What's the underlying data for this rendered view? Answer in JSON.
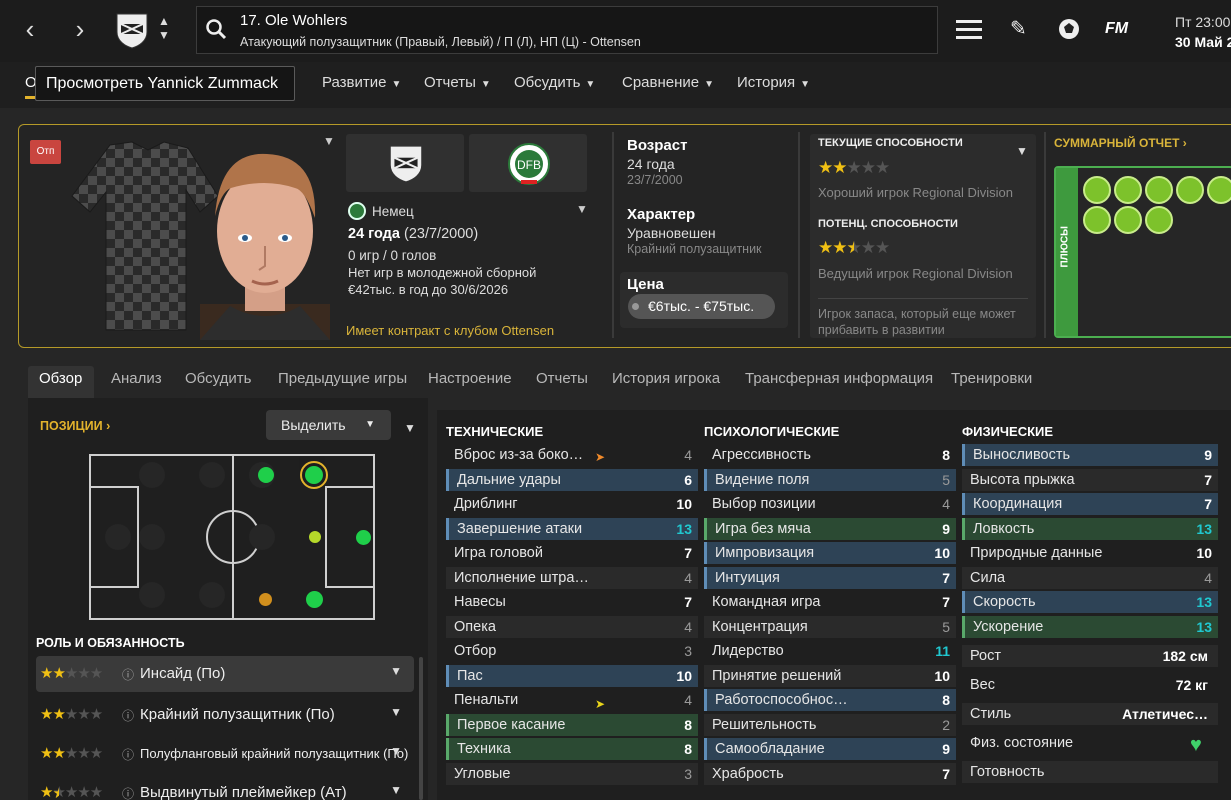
{
  "header": {
    "player_title": "17. Ole Wohlers",
    "player_subtitle": "Атакующий полузащитник (Правый, Левый) / П (Л), НП (Ц) - Ottensen",
    "fm_label": "FM",
    "day": "Пт 23:00",
    "date": "30 Май 2"
  },
  "tooltip": "Просмотреть Yannick Zummack",
  "menu": {
    "first": "О",
    "items": [
      "Развитие",
      "Отчеты",
      "Обсудить",
      "Сравнение",
      "История"
    ]
  },
  "profile": {
    "badge": "Отп",
    "nationality": "Немец",
    "age": "24 года",
    "dob": "(23/7/2000)",
    "games": "0 игр / 0 голов",
    "youth": "Нет игр в молодежной сборной",
    "wage": "€42тыс. в год до 30/6/2026",
    "contract": "Имеет контракт с клубом Ottensen",
    "age_label": "Возраст",
    "age_value": "24 года",
    "age_dob": "23/7/2000",
    "char_label": "Характер",
    "char_value": "Уравновешен",
    "char_sub": "Крайний полузащитник",
    "price_label": "Цена",
    "price_value": "€6тыс. - €75тыс.",
    "ca_label": "ТЕКУЩИЕ СПОСОБНОСТИ",
    "ca_desc": "Хороший игрок Regional Division",
    "pa_label": "ПОТЕНЦ. СПОСОБНОСТИ",
    "pa_desc": "Ведущий игрок Regional Division",
    "note": "Игрок запаса, который еще может прибавить в развитии",
    "summary_label": "СУММАРНЫЙ ОТЧЕТ",
    "plus_label": "ПЛЮСЫ"
  },
  "ratings": {
    "ca_stars": 2,
    "pa_stars": 2.5
  },
  "tabs": [
    "Обзор",
    "Анализ",
    "Обсудить",
    "Предыдущие игры",
    "Настроение",
    "Отчеты",
    "История игрока",
    "Трансферная информация",
    "Тренировки"
  ],
  "positions": {
    "label": "ПОЗИЦИИ",
    "select_label": "Выделить"
  },
  "roles": {
    "header": "РОЛЬ И ОБЯЗАННОСТЬ",
    "items": [
      {
        "name": "Инсайд (По)",
        "stars": "★★★★★"
      },
      {
        "name": "Крайний полузащитник (По)",
        "stars": "★★★★★"
      },
      {
        "name": "Полуфланговый крайний полузащитник (По)",
        "stars": "★★★★★"
      },
      {
        "name": "Выдвинутый плеймейкер (Ат)",
        "stars": "★★★★★"
      }
    ]
  },
  "technical": {
    "title": "ТЕХНИЧЕСКИЕ",
    "rows": [
      {
        "name": "Вброс из-за боко…",
        "value": "4"
      },
      {
        "name": "Дальние удары",
        "value": "6"
      },
      {
        "name": "Дриблинг",
        "value": "10"
      },
      {
        "name": "Завершение атаки",
        "value": "13"
      },
      {
        "name": "Игра головой",
        "value": "7"
      },
      {
        "name": "Исполнение штра…",
        "value": "4"
      },
      {
        "name": "Навесы",
        "value": "7"
      },
      {
        "name": "Опека",
        "value": "4"
      },
      {
        "name": "Отбор",
        "value": "3"
      },
      {
        "name": "Пас",
        "value": "10"
      },
      {
        "name": "Пенальти",
        "value": "4"
      },
      {
        "name": "Первое касание",
        "value": "8"
      },
      {
        "name": "Техника",
        "value": "8"
      },
      {
        "name": "Угловые",
        "value": "3"
      }
    ]
  },
  "mental": {
    "title": "ПСИХОЛОГИЧЕСКИЕ",
    "rows": [
      {
        "name": "Агрессивность",
        "value": "8"
      },
      {
        "name": "Видение поля",
        "value": "5"
      },
      {
        "name": "Выбор позиции",
        "value": "4"
      },
      {
        "name": "Игра без мяча",
        "value": "9"
      },
      {
        "name": "Импровизация",
        "value": "10"
      },
      {
        "name": "Интуиция",
        "value": "7"
      },
      {
        "name": "Командная игра",
        "value": "7"
      },
      {
        "name": "Концентрация",
        "value": "5"
      },
      {
        "name": "Лидерство",
        "value": "11"
      },
      {
        "name": "Принятие решений",
        "value": "10"
      },
      {
        "name": "Работоспособнос…",
        "value": "8"
      },
      {
        "name": "Решительность",
        "value": "2"
      },
      {
        "name": "Самообладание",
        "value": "9"
      },
      {
        "name": "Храбрость",
        "value": "7"
      }
    ]
  },
  "physical": {
    "title": "ФИЗИЧЕСКИЕ",
    "rows": [
      {
        "name": "Выносливость",
        "value": "9"
      },
      {
        "name": "Высота прыжка",
        "value": "7"
      },
      {
        "name": "Координация",
        "value": "7"
      },
      {
        "name": "Ловкость",
        "value": "13"
      },
      {
        "name": "Природные данные",
        "value": "10"
      },
      {
        "name": "Сила",
        "value": "4"
      },
      {
        "name": "Скорость",
        "value": "13"
      },
      {
        "name": "Ускорение",
        "value": "13"
      }
    ],
    "info": [
      {
        "name": "Рост",
        "value": "182 см"
      },
      {
        "name": "Вес",
        "value": "72 кг"
      },
      {
        "name": "Стиль",
        "value": "Атлетичес…"
      },
      {
        "name": "Физ. состояние",
        "value": ""
      },
      {
        "name": "Готовность",
        "value": ""
      }
    ]
  },
  "colors": {
    "accent": "#e3b32c",
    "blue_hl": "#2e4356",
    "green_hl": "#2b4a33",
    "high_value": "#20c8d0"
  }
}
